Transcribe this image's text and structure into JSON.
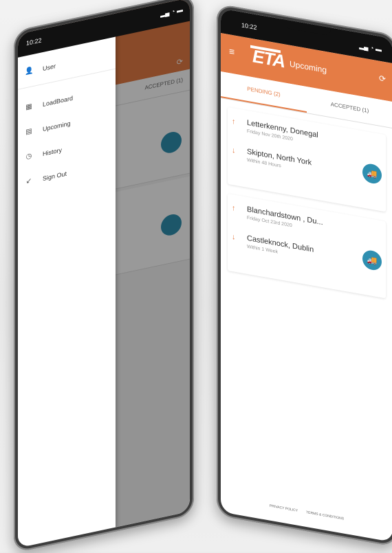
{
  "left_phone": {
    "status_time": "10:22",
    "status_icons": "▂▄ ◔ ▬",
    "drawer_items": [
      {
        "label": "User",
        "icon": "person-icon",
        "glyph": "👤"
      },
      {
        "label": "LoadBoard",
        "icon": "board-icon",
        "glyph": "▦"
      },
      {
        "label": "Upcoming",
        "icon": "calendar-icon",
        "glyph": "▤"
      },
      {
        "label": "History",
        "icon": "clock-icon",
        "glyph": "◷"
      },
      {
        "label": "Sign Out",
        "icon": "signout-icon",
        "glyph": "↙"
      }
    ],
    "background_tab_accepted": "ACCEPTED (1)",
    "background_refresh_icon": "⟳"
  },
  "right_phone": {
    "status_time": "10:22",
    "status_icons": "▂▄ ◔ ▬",
    "menu_glyph": "≡",
    "logo": "ETA",
    "title": "Upcoming",
    "refresh_glyph": "⟳",
    "tabs": {
      "pending": "PENDING (2)",
      "accepted": "ACCEPTED (1)"
    },
    "jobs": [
      {
        "from_city": "Letterkenny, Donegal",
        "from_date": "Friday Nov 20th 2020",
        "to_city": "Skipton, North York",
        "to_window": "Within 48 Hours"
      },
      {
        "from_city": "Blanchardstown , Du...",
        "from_date": "Friday Oct 23rd 2020",
        "to_city": "Castleknock, Dublin",
        "to_window": "Within 1 Week"
      }
    ],
    "arrow_up": "↑",
    "arrow_down": "↓",
    "truck_glyph": "🚚",
    "footer": {
      "privacy": "PRIVACY POLICY",
      "terms": "TERMS & CONDITIONS"
    }
  },
  "colors": {
    "brand_orange": "#e57c45",
    "truck_blue": "#2f8fb0"
  }
}
